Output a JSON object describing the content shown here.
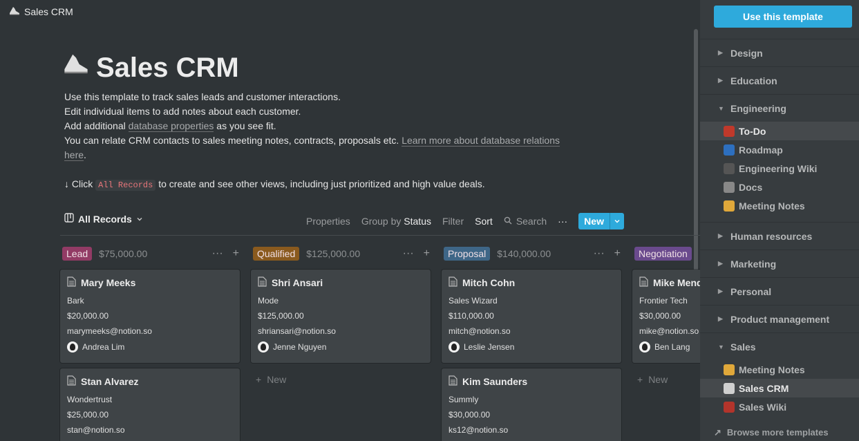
{
  "topbar": {
    "title": "Sales CRM"
  },
  "page": {
    "title": "Sales CRM",
    "desc": {
      "line1": "Use this template to track sales leads and customer interactions.",
      "line2": "Edit individual items to add notes about each customer.",
      "line3_pre": "Add additional ",
      "line3_link": "database properties",
      "line3_post": " as you see fit.",
      "line4_pre": "You can relate CRM contacts to sales meeting notes, contracts, proposals etc. ",
      "line4_link": "Learn more about database relations ",
      "line4_link2": "here",
      "line4_post": ".",
      "line5_pre": "↓ Click ",
      "line5_code": "All Records",
      "line5_post": " to create and see other views, including just prioritized and high value deals."
    }
  },
  "viewbar": {
    "view_label": "All Records",
    "properties": "Properties",
    "group_by": "Group by",
    "group_value": "Status",
    "filter": "Filter",
    "sort": "Sort",
    "search": "Search",
    "more": "···",
    "new": "New"
  },
  "board": {
    "columns": [
      {
        "tag": "Lead",
        "tag_color": "#923b65",
        "sum": "$75,000.00"
      },
      {
        "tag": "Qualified",
        "tag_color": "#8a5a1e",
        "sum": "$125,000.00"
      },
      {
        "tag": "Proposal",
        "tag_color": "#3e6687",
        "sum": "$140,000.00"
      },
      {
        "tag": "Negotiation",
        "tag_color": "#6a4a8d",
        "sum": ""
      }
    ],
    "cards": [
      {
        "name": "Mary Meeks",
        "company": "Bark",
        "value": "$20,000.00",
        "email": "marymeeks@notion.so",
        "owner": "Andrea Lim"
      },
      {
        "name": "Stan Alvarez",
        "company": "Wondertrust",
        "value": "$25,000.00",
        "email": "stan@notion.so",
        "owner": ""
      },
      {
        "name": "Shri Ansari",
        "company": "Mode",
        "value": "$125,000.00",
        "email": "shriansari@notion.so",
        "owner": "Jenne Nguyen"
      },
      {
        "name": "Mitch Cohn",
        "company": "Sales Wizard",
        "value": "$110,000.00",
        "email": "mitch@notion.so",
        "owner": "Leslie Jensen"
      },
      {
        "name": "Kim Saunders",
        "company": "Summly",
        "value": "$30,000.00",
        "email": "ks12@notion.so",
        "owner": ""
      },
      {
        "name": "Mike Mend",
        "company": "Frontier Tech",
        "value": "$30,000.00",
        "email": "mike@notion.so",
        "owner": "Ben Lang"
      }
    ],
    "add_new": "New"
  },
  "sidebar": {
    "use_button": "Use this template",
    "sections": {
      "design": "Design",
      "education": "Education",
      "engineering": "Engineering",
      "hr": "Human resources",
      "marketing": "Marketing",
      "personal": "Personal",
      "pm": "Product management",
      "sales": "Sales"
    },
    "engineering_items": [
      "To-Do",
      "Roadmap",
      "Engineering Wiki",
      "Docs",
      "Meeting Notes"
    ],
    "sales_items": [
      "Meeting Notes",
      "Sales CRM",
      "Sales Wiki"
    ],
    "browse": "Browse more templates"
  },
  "colors": {
    "accent": "#2eaadc",
    "bg": "#2f3437",
    "sidebar": "#373c3f"
  }
}
